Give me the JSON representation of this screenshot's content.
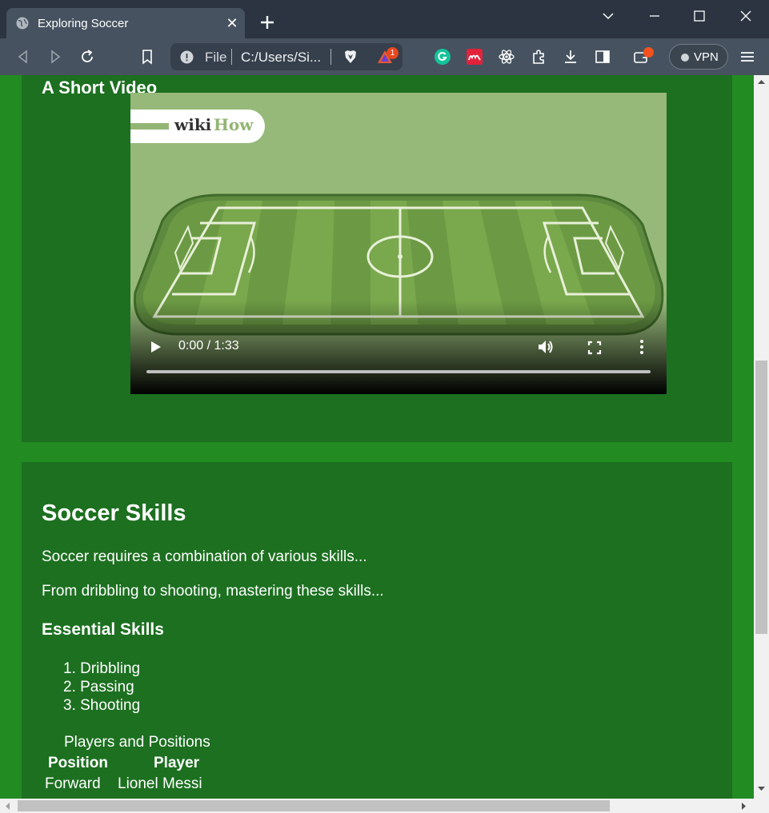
{
  "browser": {
    "tab_title": "Exploring Soccer",
    "address_scheme": "File",
    "address_url": "C:/Users/Si...",
    "vpn_label": "VPN",
    "notification_count": "1",
    "accent": "#4caf50"
  },
  "video_section": {
    "heading": "A Short Video",
    "logo_wiki": "wiki",
    "logo_how": "How",
    "time": "0:00 / 1:33"
  },
  "skills_section": {
    "heading": "Soccer Skills",
    "para1": "Soccer requires a combination of various skills...",
    "para2": "From dribbling to shooting, mastering these skills...",
    "subheading": "Essential Skills",
    "skills": [
      "1. Dribbling",
      "2. Passing",
      "3. Shooting"
    ],
    "table_caption": "Players and Positions",
    "table_headers": [
      "Position",
      "Player"
    ],
    "table_rows": [
      [
        "Forward",
        "Lionel Messi"
      ]
    ]
  },
  "colors": {
    "page_bg": "#228b22",
    "section_bg": "#1c7020",
    "text": "#ffffff"
  }
}
